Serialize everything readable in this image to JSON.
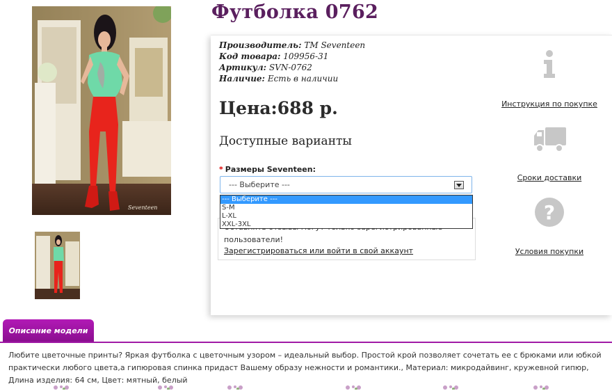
{
  "product": {
    "title": "Футболка 0762",
    "manufacturer_label": "Производитель:",
    "manufacturer_value": "TM Seventeen",
    "code_label": "Код товара:",
    "code_value": "109956-31",
    "sku_label": "Артикул:",
    "sku_value": "SVN-0762",
    "stock_label": "Наличие:",
    "stock_value": "Есть в наличии",
    "price": "Цена:688 р.",
    "variants_title": "Доступные варианты",
    "size_label": "Размеры Seventeen:",
    "required_mark": "*"
  },
  "photo": {
    "watermark": "Seventeen"
  },
  "size_select": {
    "value": "--- Выберите ---",
    "options": [
      "--- Выберите ---",
      "S-M",
      "L-XL",
      "XXL-3XL"
    ]
  },
  "login_notice": {
    "line1": "Оставлять отзывы могут только зарегистрированные",
    "line2": "пользователи!",
    "link": "Зарегистрироваться или войти в свой аккаунт"
  },
  "sidebar": {
    "items": [
      {
        "label": "Инструкция по покупке",
        "icon": "info-icon"
      },
      {
        "label": "Сроки доставки",
        "icon": "truck-icon"
      },
      {
        "label": "Условия покупки",
        "icon": "question-icon"
      }
    ]
  },
  "description": {
    "tab_label": "Описание модели",
    "text": "Любите цветочные принты? Яркая футболка с цветочным узором – идеальный выбор. Простой крой позволяет сочетать ее с брюками или юбкой практически любого цвета,а гипюровая спинка придаст Вашему образу нежности и романтики., Материал: микродайвинг, кружевной гипюр, Длина изделия: 64 см, Цвет: мятный, белый"
  },
  "colors": {
    "title": "#5a1f5e",
    "accent": "#a01aa5",
    "select_highlight": "#3399ff",
    "pants": "#e8241c",
    "shirt": "#6fd9a8"
  }
}
